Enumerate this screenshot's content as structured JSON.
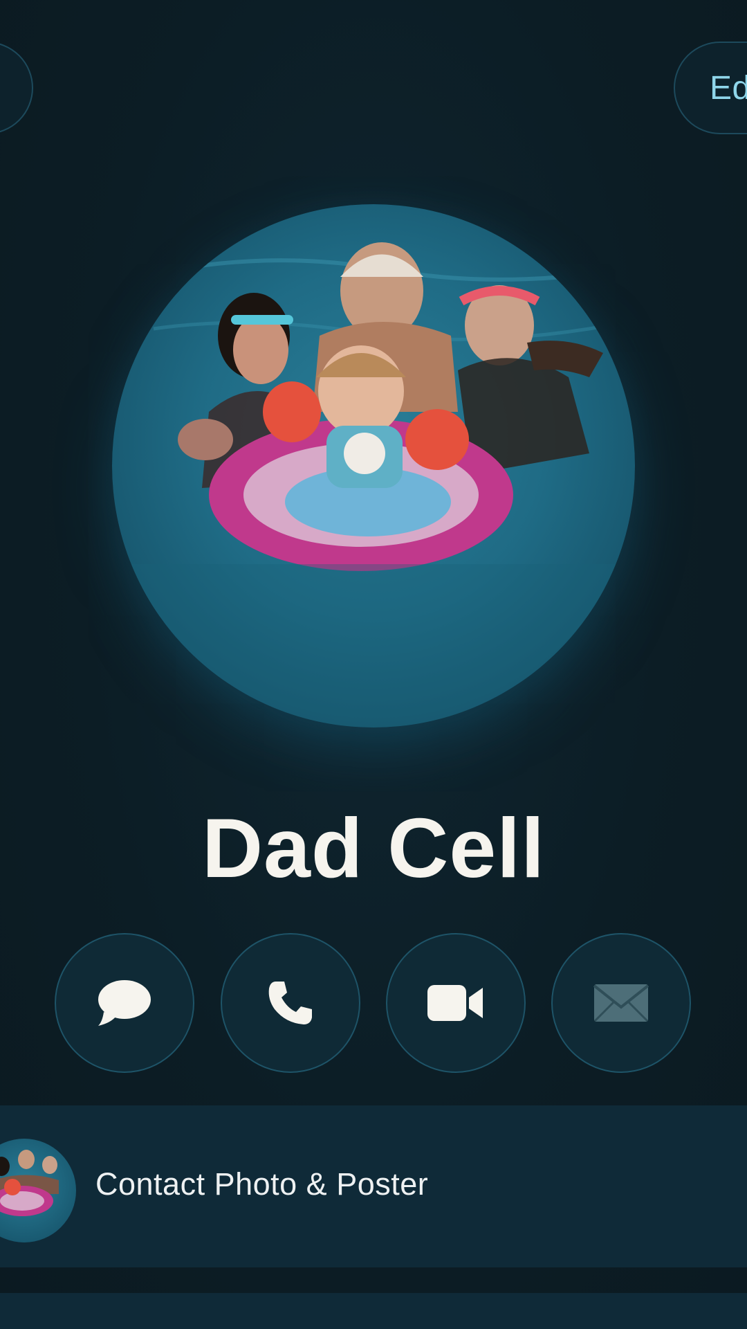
{
  "header": {
    "edit_label": "Ed"
  },
  "contact": {
    "name": "Dad Cell"
  },
  "actions": {
    "message": "message-icon",
    "call": "phone-icon",
    "video": "video-icon",
    "mail": "mail-icon"
  },
  "rows": {
    "contact_photo_label": "Contact Photo & Poster"
  },
  "colors": {
    "background": "#0c1d25",
    "accent": "#8fd6ea",
    "name_text": "#f6f4ee",
    "button_border": "#1e5468"
  }
}
